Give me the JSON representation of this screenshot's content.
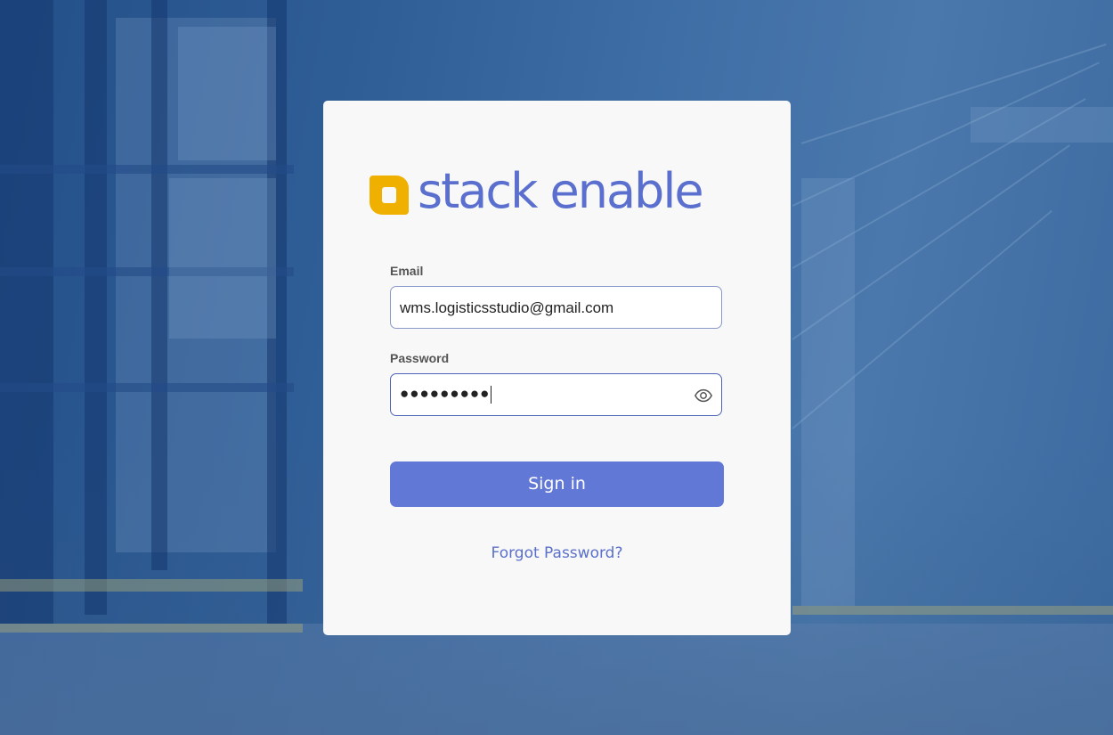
{
  "brand": {
    "name": "stack enable",
    "primary_color": "#5b6fcf",
    "mark_color": "#f0b000"
  },
  "form": {
    "email_label": "Email",
    "email_value": "wms.logisticsstudio@gmail.com",
    "password_label": "Password",
    "password_masked": "●●●●●●●●●",
    "show_password_icon": "eye-icon",
    "signin_label": "Sign in",
    "forgot_label": "Forgot Password?"
  },
  "colors": {
    "button": "#6278d6",
    "link": "#5b70c9",
    "card": "#f8f8f8",
    "background": "#2f5d95"
  }
}
